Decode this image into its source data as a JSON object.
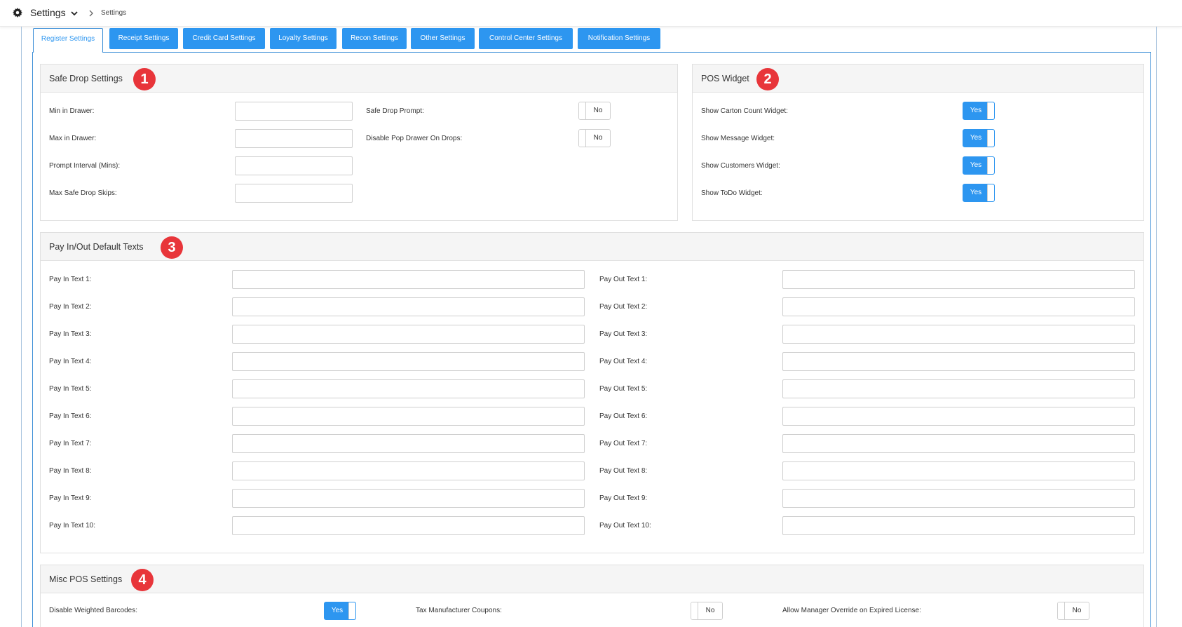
{
  "topbar": {
    "title": "Settings",
    "breadcrumb": "Settings"
  },
  "tabs": [
    {
      "label": "Register Settings",
      "active": true
    },
    {
      "label": "Receipt Settings"
    },
    {
      "label": "Credit Card Settings"
    },
    {
      "label": "Loyalty Settings"
    },
    {
      "label": "Recon Settings"
    },
    {
      "label": "Other Settings"
    },
    {
      "label": "Control Center Settings"
    },
    {
      "label": "Notification Settings"
    }
  ],
  "safe_drop": {
    "title": "Safe Drop Settings",
    "badge": "1",
    "fields": [
      {
        "label": "Min in Drawer:",
        "value": ""
      },
      {
        "label": "Max in Drawer:",
        "value": ""
      },
      {
        "label": "Prompt Interval (Mins):",
        "value": ""
      },
      {
        "label": "Max Safe Drop Skips:",
        "value": ""
      }
    ],
    "toggles": [
      {
        "label": "Safe Drop Prompt:",
        "value": "No"
      },
      {
        "label": "Disable Pop Drawer On Drops:",
        "value": "No"
      }
    ]
  },
  "pos_widget": {
    "title": "POS Widget",
    "badge": "2",
    "toggles": [
      {
        "label": "Show Carton Count Widget:",
        "value": "Yes"
      },
      {
        "label": "Show Message Widget:",
        "value": "Yes"
      },
      {
        "label": "Show Customers Widget:",
        "value": "Yes"
      },
      {
        "label": "Show ToDo Widget:",
        "value": "Yes"
      }
    ]
  },
  "pay_in_out": {
    "title": "Pay In/Out Default Texts",
    "badge": "3",
    "pay_in": [
      {
        "label": "Pay In Text 1:"
      },
      {
        "label": "Pay In Text 2:"
      },
      {
        "label": "Pay In Text 3:"
      },
      {
        "label": "Pay In Text 4:"
      },
      {
        "label": "Pay In Text 5:"
      },
      {
        "label": "Pay In Text 6:"
      },
      {
        "label": "Pay In Text 7:"
      },
      {
        "label": "Pay In Text 8:"
      },
      {
        "label": "Pay In Text 9:"
      },
      {
        "label": "Pay In Text 10:"
      }
    ],
    "pay_out": [
      {
        "label": "Pay Out Text 1:"
      },
      {
        "label": "Pay Out Text 2:"
      },
      {
        "label": "Pay Out Text 3:"
      },
      {
        "label": "Pay Out Text 4:"
      },
      {
        "label": "Pay Out Text 5:"
      },
      {
        "label": "Pay Out Text 6:"
      },
      {
        "label": "Pay Out Text 7:"
      },
      {
        "label": "Pay Out Text 8:"
      },
      {
        "label": "Pay Out Text 9:"
      },
      {
        "label": "Pay Out Text 10:"
      }
    ]
  },
  "misc_pos": {
    "title": "Misc POS Settings",
    "badge": "4",
    "toggles": [
      {
        "label": "Disable Weighted Barcodes:",
        "value": "Yes"
      },
      {
        "label": "Tax Manufacturer Coupons:",
        "value": "No"
      },
      {
        "label": "Allow Manager Override on Expired License:",
        "value": "No"
      }
    ]
  },
  "colors": {
    "accent": "#2d96f0",
    "badge": "#e8353a",
    "panel_header": "#f5f5f5"
  }
}
